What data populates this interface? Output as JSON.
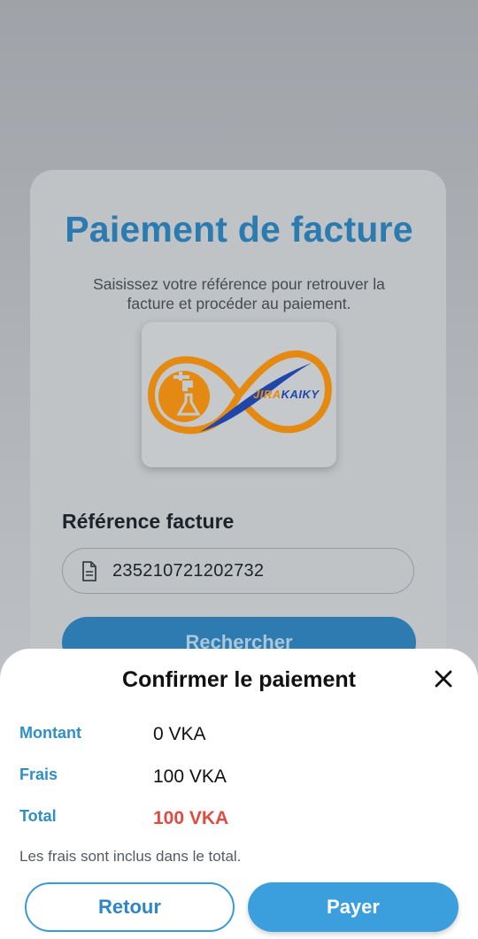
{
  "colors": {
    "title": "#2b7bb0",
    "accent": "#3a9fdc",
    "total": "#e04b42",
    "label": "#2f8fc4"
  },
  "page": {
    "title": "Paiement de facture",
    "subtitle": "Saisissez votre référence pour retrouver la facture et procéder au paiement.",
    "logo": {
      "icon": "faucet-flask-infinity-logo",
      "brand_part1": "JIRA",
      "brand_part2": "KAIKY"
    },
    "reference": {
      "label": "Référence facture",
      "icon": "document-icon",
      "value": "235210721202732"
    },
    "search_button": "Rechercher"
  },
  "dialog": {
    "title": "Confirmer le paiement",
    "close_icon": "close-icon",
    "rows": [
      {
        "label": "Montant",
        "value": "0 VKA"
      },
      {
        "label": "Frais",
        "value": "100 VKA"
      },
      {
        "label": "Total",
        "value": "100 VKA"
      }
    ],
    "note": "Les frais sont inclus dans le total.",
    "back_button": "Retour",
    "pay_button": "Payer"
  }
}
